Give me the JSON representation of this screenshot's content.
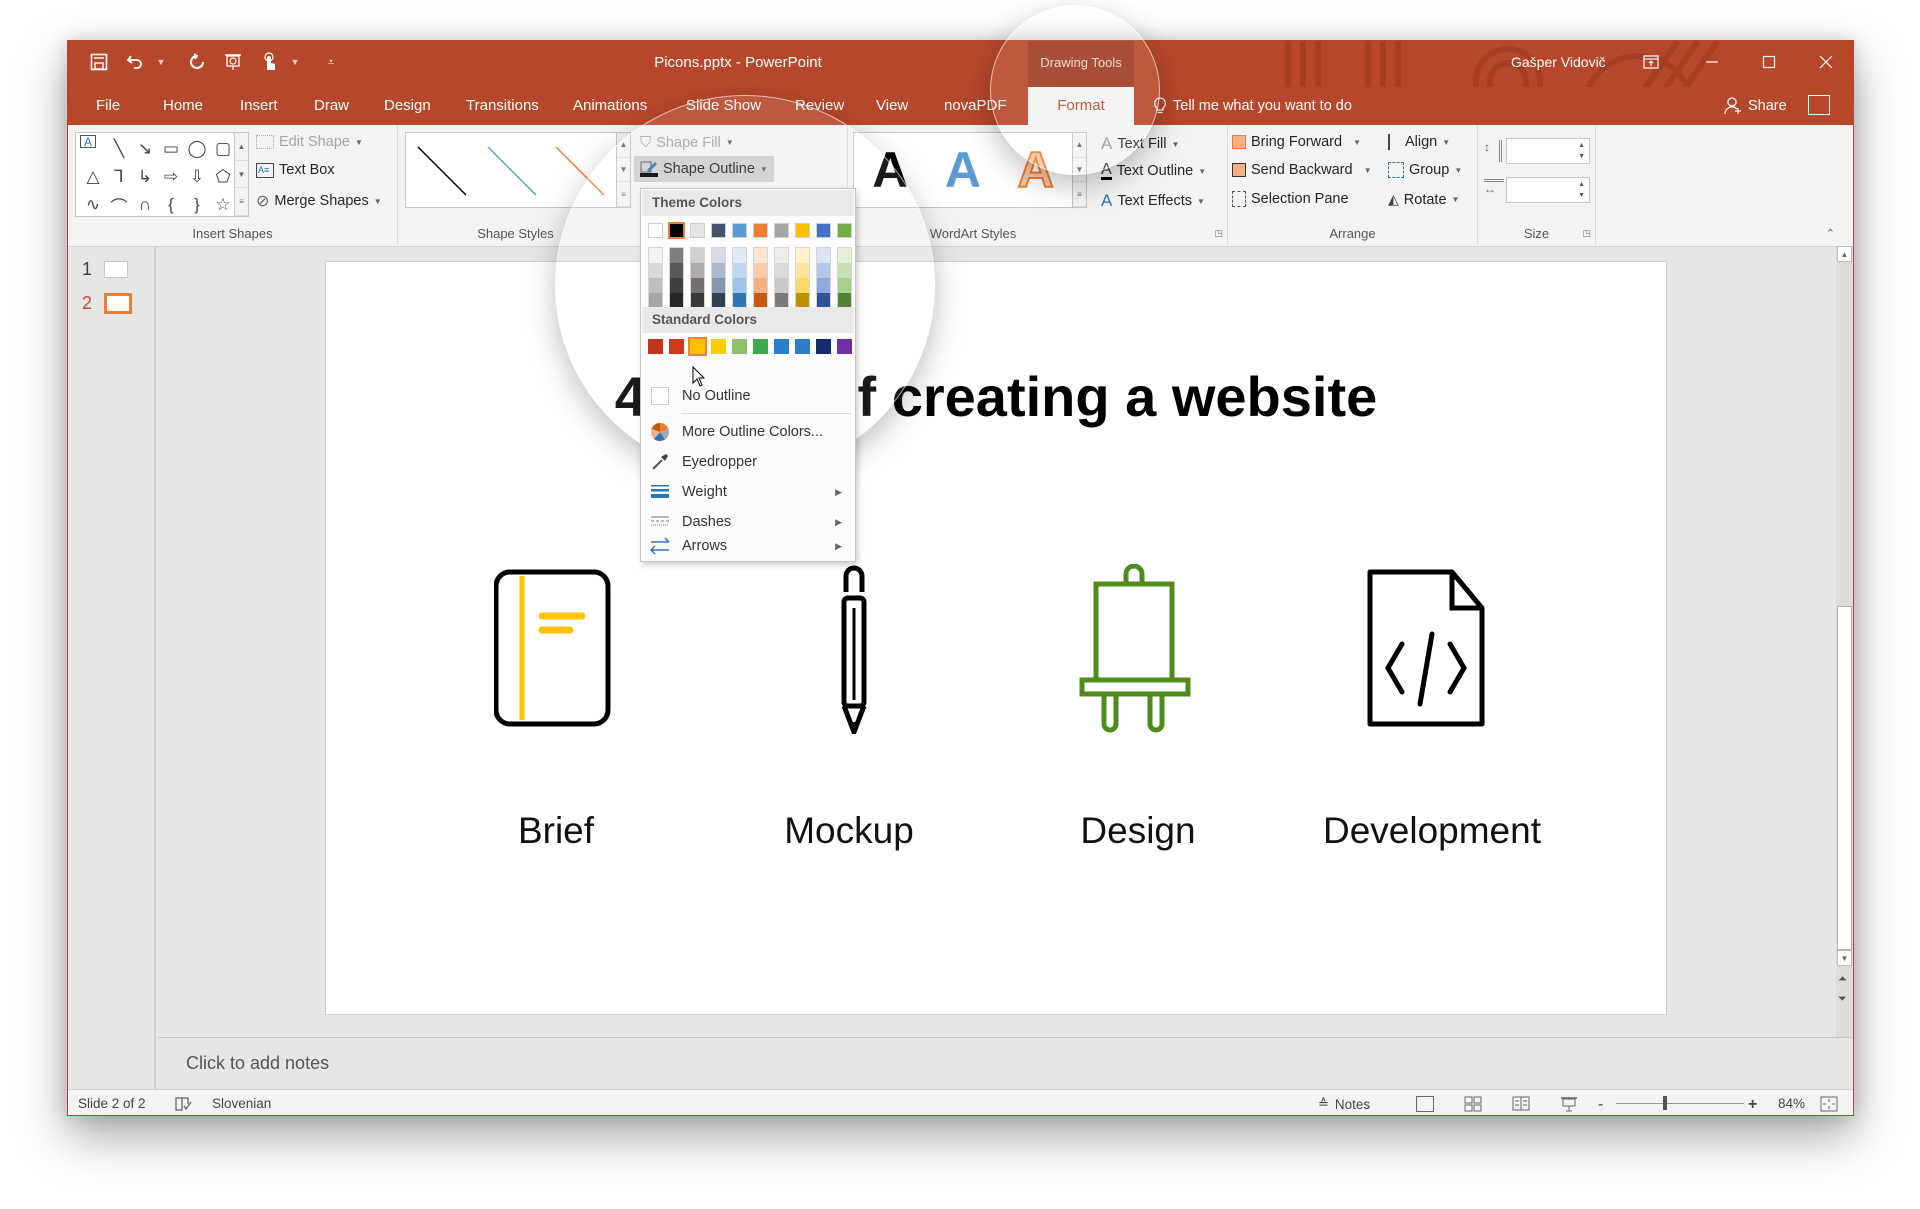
{
  "window": {
    "title": "Picons.pptx - PowerPoint",
    "context_tab_group": "Drawing Tools",
    "user": "Gašper Vidovič",
    "controls": [
      "ribbon-display-options",
      "minimize",
      "maximize",
      "close"
    ]
  },
  "quick_access": [
    "save-icon",
    "undo-icon",
    "redo-icon",
    "present-from-beginning-icon",
    "touch-mode-icon",
    "customize-icon"
  ],
  "tabs": [
    {
      "label": "File"
    },
    {
      "label": "Home"
    },
    {
      "label": "Insert"
    },
    {
      "label": "Draw"
    },
    {
      "label": "Design"
    },
    {
      "label": "Transitions"
    },
    {
      "label": "Animations"
    },
    {
      "label": "Slide Show"
    },
    {
      "label": "Review"
    },
    {
      "label": "View"
    },
    {
      "label": "novaPDF"
    },
    {
      "label": "Format",
      "active": true
    }
  ],
  "tell_me": "Tell me what you want to do",
  "share": "Share",
  "ribbon": {
    "insert_shapes": {
      "label": "Insert Shapes",
      "edit_shape": "Edit Shape",
      "text_box": "Text Box",
      "merge_shapes": "Merge Shapes"
    },
    "shape_styles": {
      "label": "Shape Styles",
      "line_colors": [
        "#000000",
        "#5b9bd5",
        "#ed7d31"
      ],
      "shape_fill": "Shape Fill",
      "shape_outline": "Shape Outline"
    },
    "wordart_styles": {
      "label": "WordArt Styles",
      "sample_letter": "A",
      "text_fill": "Text Fill",
      "text_outline": "Text Outline",
      "text_effects": "Text Effects"
    },
    "arrange": {
      "label": "Arrange",
      "bring_forward": "Bring Forward",
      "send_backward": "Send Backward",
      "selection_pane": "Selection Pane",
      "align": "Align",
      "group": "Group",
      "rotate": "Rotate"
    },
    "size": {
      "label": "Size",
      "height_value": "",
      "width_value": ""
    }
  },
  "shape_outline_menu": {
    "theme_colors_header": "Theme Colors",
    "theme_colors": [
      "#ffffff",
      "#000000",
      "#e7e6e6",
      "#44546a",
      "#5b9bd5",
      "#ed7d31",
      "#a5a5a5",
      "#ffc000",
      "#4472c4",
      "#70ad47"
    ],
    "theme_tints": [
      [
        "#f2f2f2",
        "#d9d9d9",
        "#bfbfbf",
        "#a6a6a6",
        "#808080"
      ],
      [
        "#7f7f7f",
        "#595959",
        "#3f3f3f",
        "#262626",
        "#0d0d0d"
      ],
      [
        "#d0cece",
        "#aeabab",
        "#757070",
        "#3a3838",
        "#171616"
      ],
      [
        "#d6dce4",
        "#adb9ca",
        "#8496b0",
        "#323f4f",
        "#222a35"
      ],
      [
        "#deebf6",
        "#bdd7ee",
        "#9dc3e6",
        "#2e75b5",
        "#1f4e79"
      ],
      [
        "#fbe5d5",
        "#f7cbac",
        "#f4b183",
        "#c55a11",
        "#833c0b"
      ],
      [
        "#ededed",
        "#dbdbdb",
        "#c9c9c9",
        "#7b7b7b",
        "#525252"
      ],
      [
        "#fff2cc",
        "#fee599",
        "#ffd965",
        "#bf9000",
        "#7f6000"
      ],
      [
        "#dae3f3",
        "#b4c7e7",
        "#8faadc",
        "#2f5496",
        "#1f3864"
      ],
      [
        "#e2efd9",
        "#c5e0b3",
        "#a8d08d",
        "#538135",
        "#375623"
      ]
    ],
    "standard_colors_header": "Standard Colors",
    "standard_colors": [
      "#c00000",
      "#ff0000",
      "#ffc000",
      "#ffff00",
      "#92d050",
      "#00b050",
      "#00b0f0",
      "#0070c0",
      "#002060",
      "#7030a0"
    ],
    "standard_colors_display": [
      "#c5341a",
      "#cc3a1a",
      "#ffc000",
      "#ffcc00",
      "#8fbf68",
      "#3caa48",
      "#2a7fc8",
      "#2d7fc6",
      "#122c6b",
      "#7030a0"
    ],
    "hovered_standard_index": 2,
    "items": [
      {
        "label": "No Outline",
        "icon": "no-outline-icon"
      },
      {
        "label": "More Outline Colors...",
        "icon": "color-wheel-icon"
      },
      {
        "label": "Eyedropper",
        "icon": "eyedropper-icon"
      },
      {
        "label": "Weight",
        "icon": "weight-icon",
        "submenu": true
      },
      {
        "label": "Dashes",
        "icon": "dashes-icon",
        "submenu": true
      },
      {
        "label": "Arrows",
        "icon": "arrows-icon",
        "submenu": true
      }
    ]
  },
  "thumbnails": [
    {
      "number": "1"
    },
    {
      "number": "2",
      "active": true
    }
  ],
  "slide": {
    "title": "4 steps of creating a website",
    "steps": [
      {
        "label": "Brief",
        "icon": "notebook-icon",
        "color": "#000000",
        "accent": "#ffc000"
      },
      {
        "label": "Mockup",
        "icon": "pencil-icon",
        "color": "#000000"
      },
      {
        "label": "Design",
        "icon": "easel-icon",
        "color": "#4e8c1c"
      },
      {
        "label": "Development",
        "icon": "code-file-icon",
        "color": "#000000"
      }
    ]
  },
  "notes_placeholder": "Click to add notes",
  "status": {
    "slide_info": "Slide 2 of 2",
    "language": "Slovenian",
    "notes": "Notes",
    "zoom": "84%",
    "zoom_minus": "-",
    "zoom_plus": "+"
  },
  "colors": {
    "accent": "#b7472a",
    "accent_dark": "#9e3b22",
    "ribbon_bg": "#f3f3f3",
    "workspace_bg": "#e6e6e6"
  }
}
